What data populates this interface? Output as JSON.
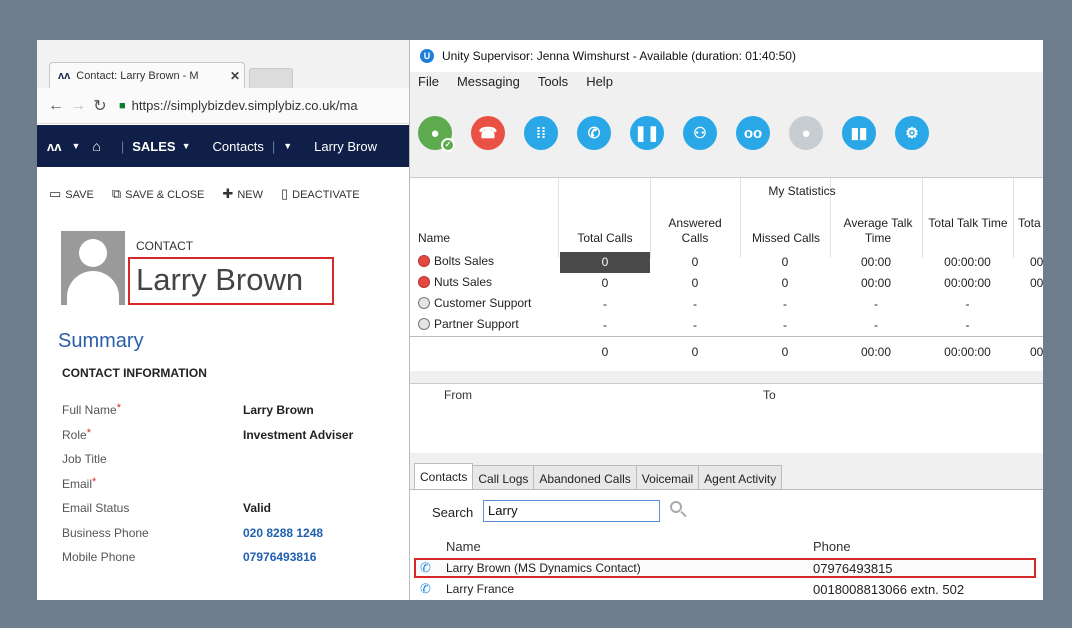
{
  "browser": {
    "tab_title": "Contact: Larry Brown - M",
    "tab_close": "✕",
    "url": "https://simplybizdev.simplybiz.co.uk/ma",
    "nav": {
      "sales": "SALES",
      "contacts": "Contacts",
      "record": "Larry Brow"
    }
  },
  "crm": {
    "toolbar": {
      "save": "SAVE",
      "save_close": "SAVE & CLOSE",
      "new": "NEW",
      "deactivate": "DEACTIVATE"
    },
    "contact_label": "CONTACT",
    "contact_name": "Larry Brown",
    "summary_title": "Summary",
    "section_title": "CONTACT INFORMATION",
    "fields": [
      {
        "label": "Full Name",
        "required": "*",
        "value": "Larry Brown"
      },
      {
        "label": "Role",
        "required": "*",
        "value": "Investment Adviser"
      },
      {
        "label": "Job Title",
        "required": "",
        "value": ""
      },
      {
        "label": "Email",
        "required": "*",
        "value": ""
      },
      {
        "label": "Email Status",
        "required": "",
        "value": "Valid"
      },
      {
        "label": "Business Phone",
        "required": "",
        "value": "020 8288 1248"
      },
      {
        "label": "Mobile Phone",
        "required": "",
        "value": "07976493816"
      }
    ]
  },
  "unity": {
    "title": "Unity Supervisor: Jenna Wimshurst - Available (duration: 01:40:50)",
    "title_icon_letter": "U",
    "menu": [
      "File",
      "Messaging",
      "Tools",
      "Help"
    ],
    "stats": {
      "title": "My Statistics",
      "headers": {
        "name": "Name",
        "total_calls": "Total Calls",
        "answered_calls": "Answered Calls",
        "missed_calls": "Missed Calls",
        "avg_talk_time": "Average Talk Time",
        "total_talk_time": "Total Talk Time",
        "total_cut": "Tota"
      },
      "rows": [
        {
          "name": "Bolts Sales",
          "status": "red",
          "total": "0",
          "answered": "0",
          "missed": "0",
          "avg": "00:00",
          "talk": "00:00:00",
          "cut": "00"
        },
        {
          "name": "Nuts Sales",
          "status": "red",
          "total": "0",
          "answered": "0",
          "missed": "0",
          "avg": "00:00",
          "talk": "00:00:00",
          "cut": "00"
        },
        {
          "name": "Customer Support",
          "status": "gray",
          "total": "-",
          "answered": "-",
          "missed": "-",
          "avg": "-",
          "talk": "-",
          "cut": ""
        },
        {
          "name": "Partner Support",
          "status": "gray",
          "total": "-",
          "answered": "-",
          "missed": "-",
          "avg": "-",
          "talk": "-",
          "cut": ""
        }
      ],
      "totals": {
        "total": "0",
        "answered": "0",
        "missed": "0",
        "avg": "00:00",
        "talk": "00:00:00",
        "cut": "00"
      }
    },
    "fromto": {
      "from": "From",
      "to": "To"
    },
    "tabs": [
      "Contacts",
      "Call Logs",
      "Abandoned Calls",
      "Voicemail",
      "Agent Activity"
    ],
    "contacts": {
      "search_label": "Search",
      "search_value": "Larry",
      "col_name": "Name",
      "col_phone": "Phone",
      "rows": [
        {
          "name": "Larry Brown (MS Dynamics Contact)",
          "phone": "07976493815"
        },
        {
          "name": "Larry France",
          "phone": "0018008813066 extn. 502"
        }
      ]
    }
  }
}
